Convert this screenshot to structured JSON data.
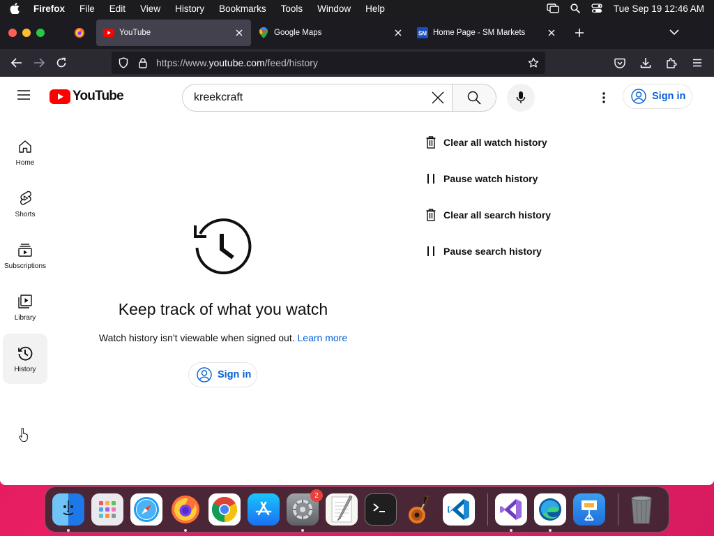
{
  "menubar": {
    "app_name": "Firefox",
    "items": [
      "File",
      "Edit",
      "View",
      "History",
      "Bookmarks",
      "Tools",
      "Window",
      "Help"
    ],
    "clock": "Tue Sep 19  12:46 AM"
  },
  "browser": {
    "tabs": [
      {
        "label": "YouTube",
        "favicon": "youtube-icon",
        "active": true
      },
      {
        "label": "Google Maps",
        "favicon": "google-maps-icon",
        "active": false
      },
      {
        "label": "Home Page - SM Markets",
        "favicon": "sm-markets-icon",
        "active": false
      }
    ],
    "url": {
      "prefix": "https://www.",
      "host": "youtube.com",
      "path": "/feed/history"
    }
  },
  "youtube": {
    "logo_text": "YouTube",
    "search": {
      "value": "kreekcraft"
    },
    "signin_label": "Sign in",
    "sidebar": [
      {
        "label": "Home",
        "icon": "home-icon"
      },
      {
        "label": "Shorts",
        "icon": "shorts-icon"
      },
      {
        "label": "Subscriptions",
        "icon": "subscriptions-icon"
      },
      {
        "label": "Library",
        "icon": "library-icon"
      },
      {
        "label": "History",
        "icon": "history-icon",
        "active": true
      }
    ],
    "empty_state": {
      "title": "Keep track of what you watch",
      "subtitle": "Watch history isn't viewable when signed out.",
      "learn_more": "Learn more",
      "signin_label": "Sign in"
    },
    "actions": [
      {
        "label": "Clear all watch history",
        "icon": "trash-icon"
      },
      {
        "label": "Pause watch history",
        "icon": "pause-icon"
      },
      {
        "label": "Clear all search history",
        "icon": "trash-icon"
      },
      {
        "label": "Pause search history",
        "icon": "pause-icon"
      }
    ],
    "colors": {
      "accent_blue": "#065fd4",
      "brand_red": "#ff0000"
    }
  },
  "dock": {
    "apps": [
      "Finder",
      "Launchpad",
      "Safari",
      "Firefox",
      "Google Chrome",
      "App Store",
      "System Settings",
      "TextEdit",
      "Terminal",
      "GarageBand",
      "Visual Studio Code",
      "Visual Studio",
      "Microsoft Edge",
      "Keynote",
      "Trash"
    ],
    "system_settings_badge": "2"
  }
}
